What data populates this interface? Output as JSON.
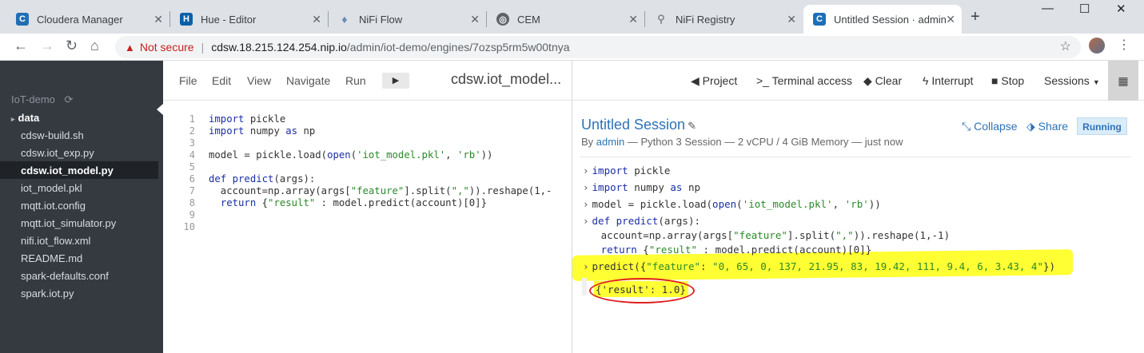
{
  "browser": {
    "tabs": [
      {
        "title": "Cloudera Manager",
        "icon": "cloudera-icon",
        "color": "#1f6fb5"
      },
      {
        "title": "Hue - Editor",
        "icon": "hue-icon",
        "color": "#0b5fa8"
      },
      {
        "title": "NiFi Flow",
        "icon": "nifi-icon",
        "color": "#6a8caf"
      },
      {
        "title": "CEM",
        "icon": "globe-icon",
        "color": "#5f6368"
      },
      {
        "title": "NiFi Registry",
        "icon": "registry-icon",
        "color": "#888888"
      },
      {
        "title": "Untitled Session · admin /",
        "icon": "cdsw-icon",
        "color": "#1f6fb5"
      }
    ],
    "security": "Not secure",
    "url_host": "cdsw.18.215.124.254.nip.io",
    "url_path": "/admin/iot-demo/engines/7ozsp5rm5w00tnya"
  },
  "sidebar": {
    "project": "IoT-demo",
    "items": [
      {
        "label": "data",
        "folder": true
      },
      {
        "label": "cdsw-build.sh"
      },
      {
        "label": "cdsw.iot_exp.py"
      },
      {
        "label": "cdsw.iot_model.py",
        "active": true
      },
      {
        "label": "iot_model.pkl"
      },
      {
        "label": "mqtt.iot.config"
      },
      {
        "label": "mqtt.iot_simulator.py"
      },
      {
        "label": "nifi.iot_flow.xml"
      },
      {
        "label": "README.md"
      },
      {
        "label": "spark-defaults.conf"
      },
      {
        "label": "spark.iot.py"
      }
    ]
  },
  "editor": {
    "menu": [
      "File",
      "Edit",
      "View",
      "Navigate",
      "Run"
    ],
    "filename": "cdsw.iot_model...",
    "line_numbers": [
      "1",
      "2",
      "3",
      "4",
      "5",
      "6",
      "7",
      "8",
      "9",
      "10"
    ]
  },
  "session": {
    "actions": {
      "project": "Project",
      "terminal": "Terminal access",
      "clear": "Clear",
      "interrupt": "Interrupt",
      "stop": "Stop",
      "sessions": "Sessions"
    },
    "title": "Untitled Session",
    "by": "By",
    "user": "admin",
    "details": "— Python 3 Session — 2 vCPU / 4 GiB Memory — just now",
    "collapse": "Collapse",
    "share": "Share",
    "status": "Running",
    "output": "{'result': 1.0}"
  }
}
